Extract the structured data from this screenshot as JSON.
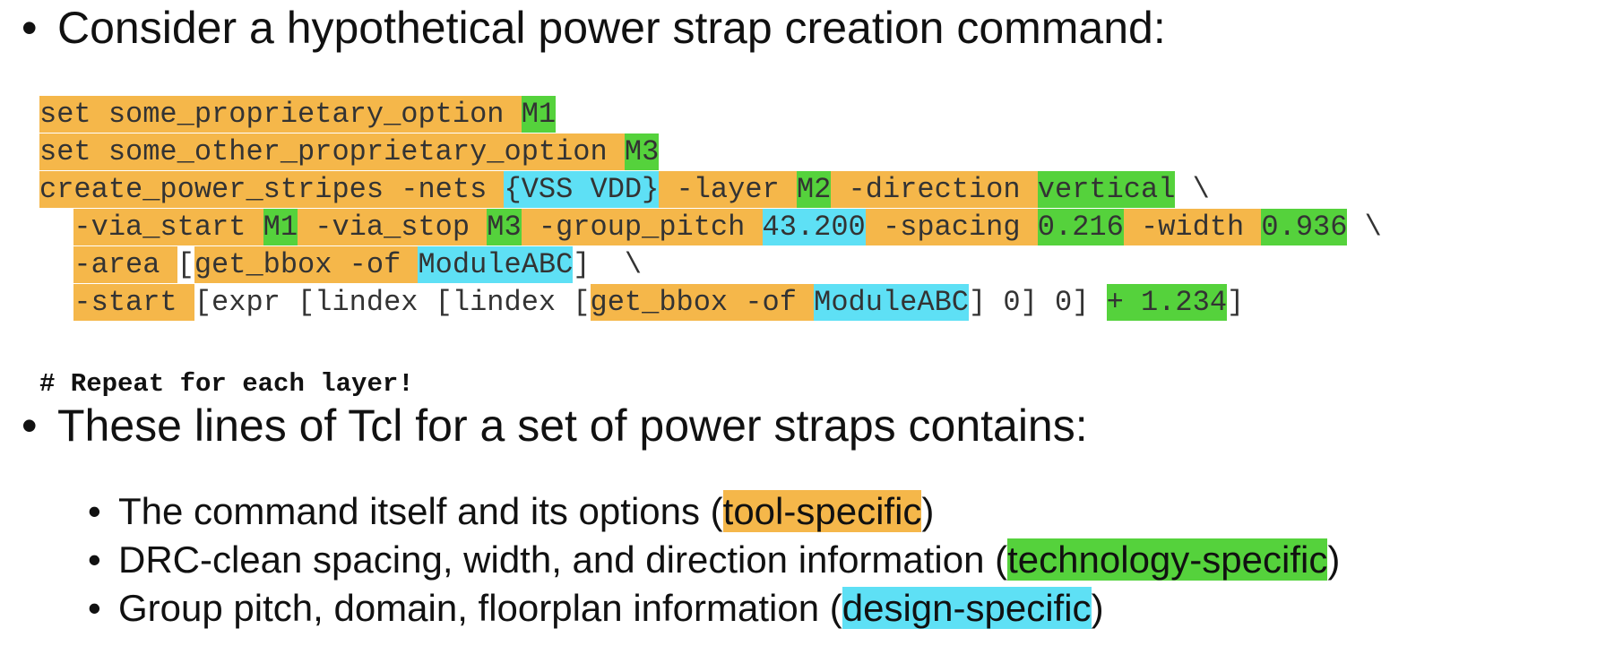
{
  "heading1": "Consider a hypothetical power strap creation command:",
  "bullet_glyph": "•",
  "code_lines": [
    [
      {
        "t": "set some_proprietary_option ",
        "c": "tool"
      },
      {
        "t": "M1",
        "c": "tech"
      }
    ],
    [
      {
        "t": "set some_other_proprietary_option ",
        "c": "tool"
      },
      {
        "t": "M3",
        "c": "tech"
      }
    ],
    [
      {
        "t": "create_power_stripes -nets ",
        "c": "tool"
      },
      {
        "t": "{VSS VDD}",
        "c": "design"
      },
      {
        "t": " -layer ",
        "c": "tool"
      },
      {
        "t": "M2",
        "c": "tech"
      },
      {
        "t": " -direction ",
        "c": "tool"
      },
      {
        "t": "vertical",
        "c": "tech"
      },
      {
        "t": " \\",
        "c": "none"
      }
    ],
    [
      {
        "t": "  ",
        "c": "none"
      },
      {
        "t": "-via_start ",
        "c": "tool"
      },
      {
        "t": "M1",
        "c": "tech"
      },
      {
        "t": " -via_stop ",
        "c": "tool"
      },
      {
        "t": "M3",
        "c": "tech"
      },
      {
        "t": " -group_pitch ",
        "c": "tool"
      },
      {
        "t": "43.200",
        "c": "design"
      },
      {
        "t": " -spacing ",
        "c": "tool"
      },
      {
        "t": "0.216",
        "c": "tech"
      },
      {
        "t": " -width ",
        "c": "tool"
      },
      {
        "t": "0.936",
        "c": "tech"
      },
      {
        "t": " \\",
        "c": "none"
      }
    ],
    [
      {
        "t": "  ",
        "c": "none"
      },
      {
        "t": "-area ",
        "c": "tool"
      },
      {
        "t": "[",
        "c": "none"
      },
      {
        "t": "get_bbox -of ",
        "c": "tool"
      },
      {
        "t": "ModuleABC",
        "c": "design"
      },
      {
        "t": "]  \\",
        "c": "none"
      }
    ],
    [
      {
        "t": "  ",
        "c": "none"
      },
      {
        "t": "-start ",
        "c": "tool"
      },
      {
        "t": "[expr [lindex [lindex [",
        "c": "none"
      },
      {
        "t": "get_bbox -of ",
        "c": "tool"
      },
      {
        "t": "ModuleABC",
        "c": "design"
      },
      {
        "t": "] 0] 0] ",
        "c": "none"
      },
      {
        "t": "+ 1.234",
        "c": "tech"
      },
      {
        "t": "]",
        "c": "none"
      }
    ]
  ],
  "comment": "# Repeat for each layer!",
  "heading2": "These lines of Tcl for a set of power straps contains:",
  "sub_items": [
    {
      "text": "The command itself and its options (",
      "highlight": "tool-specific",
      "after": ")",
      "cls": "tool"
    },
    {
      "text": "DRC-clean spacing, width, and direction information (",
      "highlight": "technology-specific",
      "after": ")",
      "cls": "tech"
    },
    {
      "text": "Group pitch, domain, floorplan information (",
      "highlight": "design-specific",
      "after": ")",
      "cls": "design"
    }
  ],
  "colors": {
    "tool": "#f5b74a",
    "tech": "#55d23c",
    "design": "#5ee0f5"
  }
}
